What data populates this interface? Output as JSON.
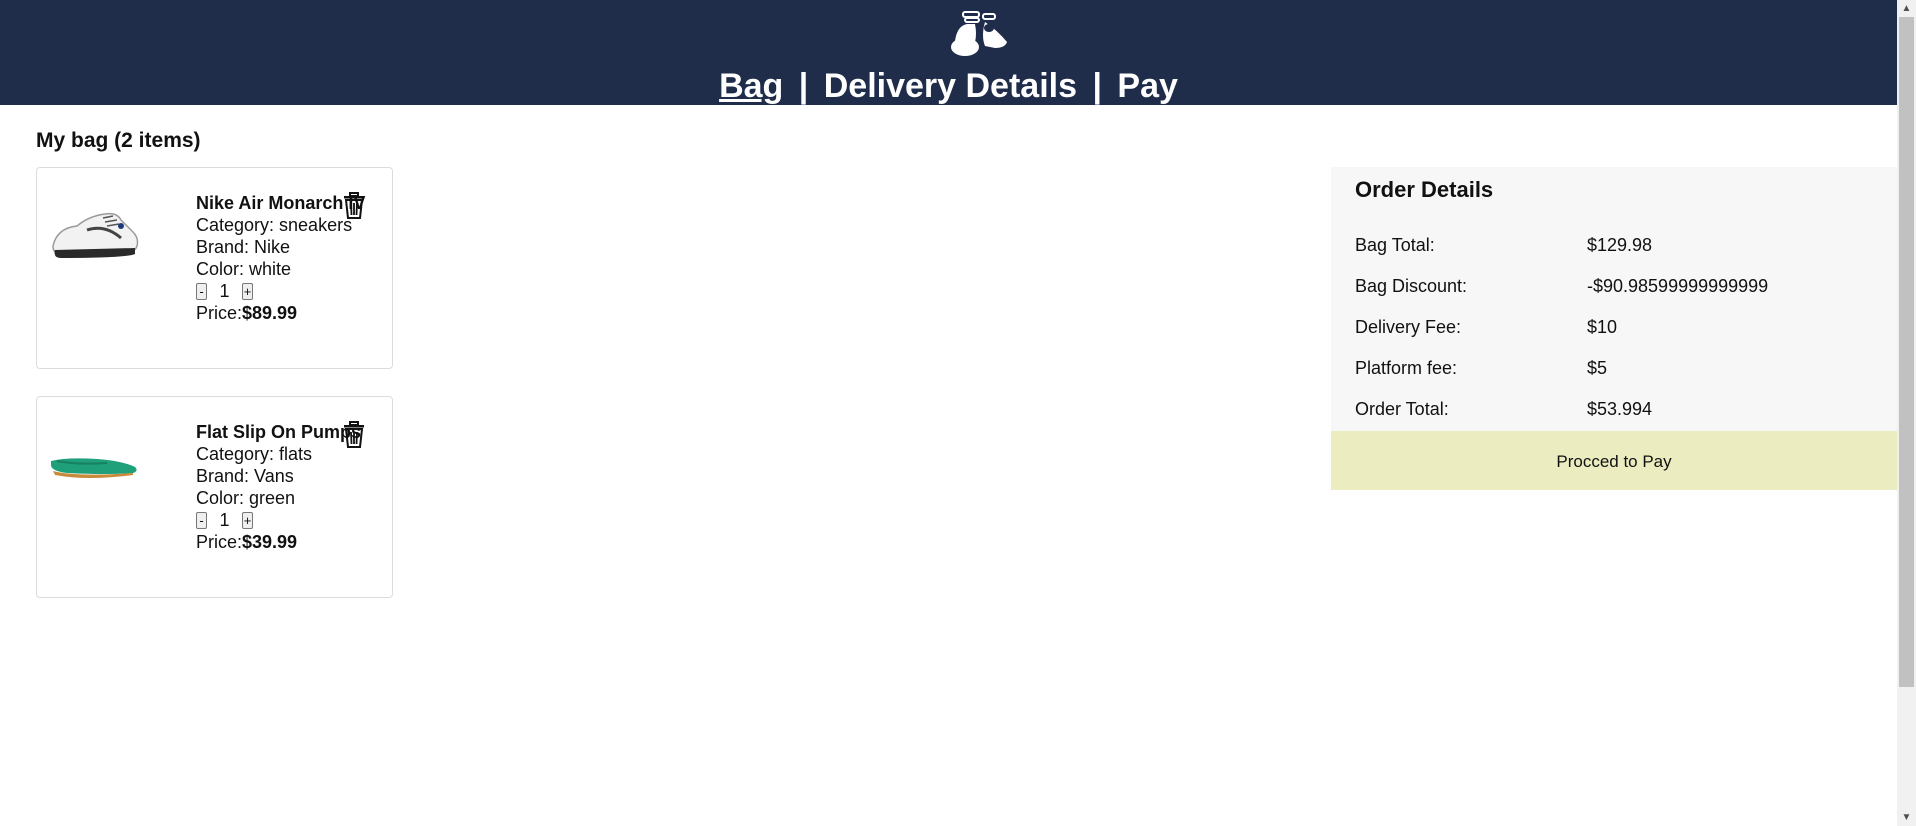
{
  "header": {
    "logo_icon": "shoes-icon",
    "steps": {
      "bag": "Bag",
      "sep1": "|",
      "delivery": "Delivery Details",
      "sep2": "|",
      "pay": "Pay"
    },
    "active_step": "Bag",
    "bg_color": "#1f2d4b"
  },
  "bag": {
    "title": "My bag (2 items)",
    "items": [
      {
        "name": "Nike Air Monarch IV",
        "category": "Category: sneakers",
        "brand": "Brand: Nike",
        "color": "Color: white",
        "qty_minus": "-",
        "qty": "1",
        "qty_plus": "+",
        "price_label": "Price:",
        "price": "$89.99",
        "image_icon": "sneaker-image",
        "delete_icon": "trash-icon"
      },
      {
        "name": "Flat Slip On Pumps",
        "category": "Category: flats",
        "brand": "Brand: Vans",
        "color": "Color: green",
        "qty_minus": "-",
        "qty": "1",
        "qty_plus": "+",
        "price_label": "Price:",
        "price": "$39.99",
        "image_icon": "flat-shoe-image",
        "delete_icon": "trash-icon"
      }
    ]
  },
  "order": {
    "title": "Order Details",
    "rows": [
      {
        "label": "Bag Total:",
        "value": "$129.98"
      },
      {
        "label": "Bag Discount:",
        "value": "-$90.98599999999999"
      },
      {
        "label": "Delivery Fee:",
        "value": "$10"
      },
      {
        "label": "Platform fee:",
        "value": "$5"
      },
      {
        "label": "Order Total:",
        "value": "$53.994"
      }
    ],
    "pay_button": "Procced to Pay",
    "pay_button_color": "#ebedc0"
  }
}
